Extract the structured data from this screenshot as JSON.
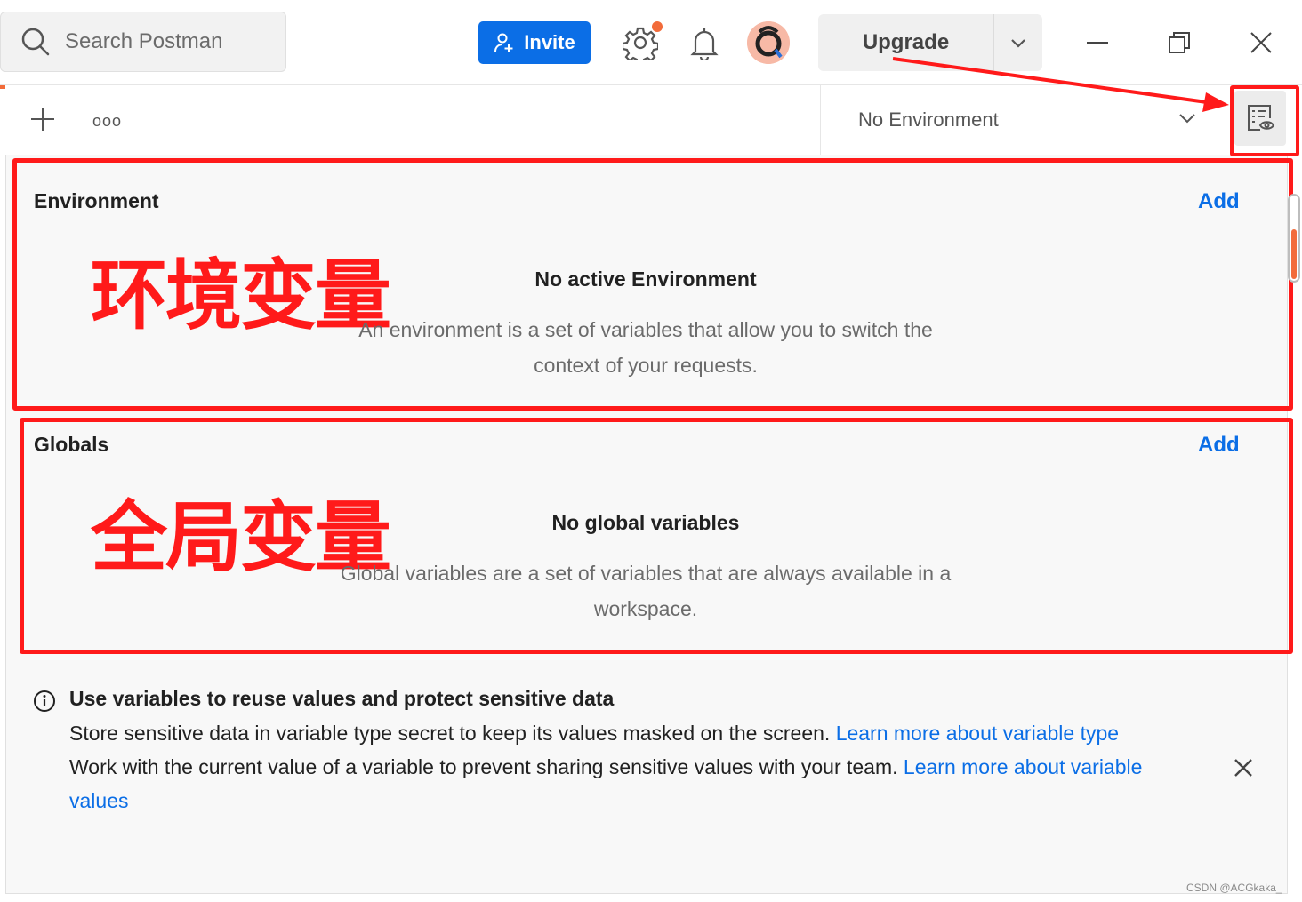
{
  "topbar": {
    "search_placeholder": "Search Postman",
    "invite_label": "Invite",
    "upgrade_label": "Upgrade"
  },
  "subbar": {
    "more_label": "ooo",
    "environment_select": "No Environment"
  },
  "environment": {
    "title": "Environment",
    "add_label": "Add",
    "empty_title": "No active Environment",
    "empty_desc_line1": "An environment is a set of variables that allow you to switch the",
    "empty_desc_line2": "context of your requests.",
    "annotation": "环境变量"
  },
  "globals": {
    "title": "Globals",
    "add_label": "Add",
    "empty_title": "No global variables",
    "empty_desc_line1": "Global variables are a set of variables that are always available in a",
    "empty_desc_line2": "workspace.",
    "annotation": "全局变量"
  },
  "info": {
    "title": "Use variables to reuse values and protect sensitive data",
    "line1_text": "Store sensitive data in variable type secret to keep its values masked on the screen. ",
    "line1_link": "Learn more about variable type",
    "line2_text": "Work with the current value of a variable to prevent sharing sensitive values with your team. ",
    "line2_link": "Learn more about variable values"
  },
  "watermark": "CSDN @ACGkaka_",
  "colors": {
    "accent_blue": "#0b6ee6",
    "annotation_red": "#ff1a1a",
    "brand_orange": "#f26b3a"
  },
  "icons": [
    "search-icon",
    "add-user-icon",
    "gear-icon",
    "bell-icon",
    "avatar",
    "chevron-down-icon",
    "minimize-icon",
    "restore-icon",
    "close-icon",
    "plus-icon",
    "environment-quick-look-icon",
    "info-icon"
  ]
}
